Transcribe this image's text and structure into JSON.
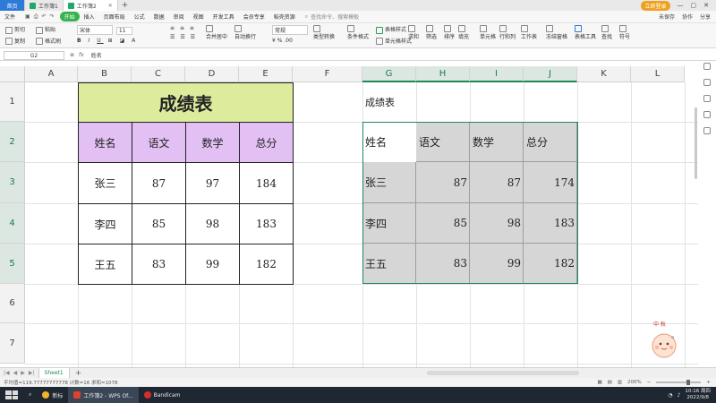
{
  "tabs": {
    "home": "首页",
    "items": [
      {
        "label": "工作簿1",
        "active": false
      },
      {
        "label": "工作簿2",
        "active": true
      }
    ],
    "login_label": "立即登录"
  },
  "menu": {
    "file": "文件",
    "items": [
      "开始",
      "插入",
      "页面布局",
      "公式",
      "数据",
      "审阅",
      "视图",
      "开发工具",
      "会员专享",
      "稻壳资源"
    ],
    "search_placeholder": "查找命令、搜索模板",
    "right_items": [
      "未保存",
      "协作",
      "分享"
    ]
  },
  "ribbon": {
    "cut": "剪切",
    "paste": "粘贴",
    "copy": "复制",
    "format_painter": "格式刷",
    "font_name": "宋体",
    "font_size": "11",
    "merge": "合并居中",
    "wrap": "自动换行",
    "number_format": "常规",
    "type_convert": "类型转换",
    "cond_format": "条件格式",
    "table_style": "表格样式",
    "cell_style": "单元格样式",
    "sum": "求和",
    "filter": "筛选",
    "sort": "排序",
    "fill": "填充",
    "cell": "单元格",
    "row_col": "行和列",
    "worksheet": "工作表",
    "freeze": "冻结窗格",
    "table_tools": "表格工具",
    "find": "查找",
    "symbol": "符号"
  },
  "formula_bar": {
    "cell_ref": "G2",
    "content": "姓名"
  },
  "columns": [
    "A",
    "B",
    "C",
    "D",
    "E",
    "F",
    "G",
    "H",
    "I",
    "J",
    "K",
    "L"
  ],
  "rows": [
    "1",
    "2",
    "3",
    "4",
    "5",
    "6",
    "7"
  ],
  "table_left": {
    "title": "成绩表",
    "headers": [
      "姓名",
      "语文",
      "数学",
      "总分"
    ],
    "rows": [
      [
        "张三",
        "87",
        "97",
        "184"
      ],
      [
        "李四",
        "85",
        "98",
        "183"
      ],
      [
        "王五",
        "83",
        "99",
        "182"
      ]
    ]
  },
  "table_right": {
    "title": "成绩表",
    "headers": [
      "姓名",
      "语文",
      "数学",
      "总分"
    ],
    "rows": [
      [
        "张三",
        "87",
        "87",
        "174"
      ],
      [
        "李四",
        "85",
        "98",
        "183"
      ],
      [
        "王五",
        "83",
        "99",
        "182"
      ]
    ]
  },
  "sheet_bar": {
    "sheet_name": "Sheet1",
    "add": "+"
  },
  "status": {
    "left": "平均值=119.77777777778  计数=16  求和=1078",
    "zoom": "200%"
  },
  "taskbar": {
    "items": [
      "新标",
      "工作簿2 - WPS Of...",
      "Bandicam"
    ],
    "time": "10:16 周四",
    "date": "2022/9/8"
  },
  "colors": {
    "title_fill": "#dcec9c",
    "header_fill": "#e2c0f3",
    "selection": "#1d8a55",
    "gray_fill": "#d6d6d6"
  }
}
